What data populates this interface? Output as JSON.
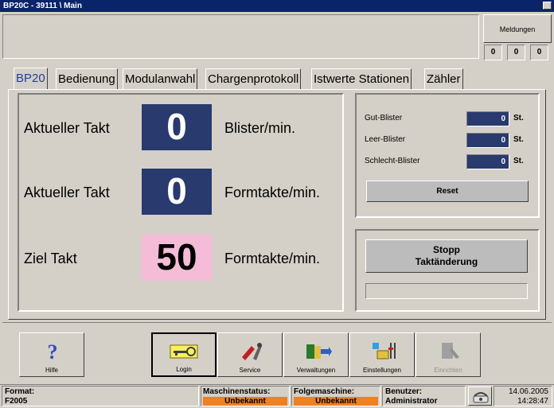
{
  "window": {
    "title": "BP20C - 39111 \\ Main"
  },
  "meldungen": {
    "label": "Meldungen",
    "counts": [
      "0",
      "0",
      "0"
    ]
  },
  "tabs": [
    "BP20",
    "Bedienung",
    "Modulanwahl",
    "Chargenprotokoll",
    "Istwerte Stationen",
    "Zähler"
  ],
  "main": {
    "row1": {
      "label": "Aktueller Takt",
      "value": "0",
      "unit": "Blister/min."
    },
    "row2": {
      "label": "Aktueller Takt",
      "value": "0",
      "unit": "Formtakte/min."
    },
    "row3": {
      "label": "Ziel Takt",
      "value": "50",
      "unit": "Formtakte/min."
    }
  },
  "counters": {
    "gut": {
      "label": "Gut-Blister",
      "value": "0",
      "unit": "St."
    },
    "leer": {
      "label": "Leer-Blister",
      "value": "0",
      "unit": "St."
    },
    "schlecht": {
      "label": "Schlecht-Blister",
      "value": "0",
      "unit": "St."
    },
    "reset_label": "Reset"
  },
  "stopp": {
    "line1": "Stopp",
    "line2": "Taktänderung"
  },
  "toolbar": {
    "hilfe": "Hilfe",
    "login": "Login",
    "service": "Service",
    "verwaltungen": "Verwaltungen",
    "einstellungen": "Einstellungen",
    "einrichten": "Einrichten"
  },
  "status": {
    "format_label": "Format:",
    "format_value": "F2005",
    "maschinen_label": "Maschinenstatus:",
    "maschinen_value": "Unbekannt",
    "folge_label": "Folgemaschine:",
    "folge_value": "Unbekannt",
    "benutzer_label": "Benutzer:",
    "benutzer_value": "Administrator",
    "date": "14.06.2005",
    "time": "14:28:47"
  },
  "colors": {
    "title_bar": "#0a246a",
    "value_dark": "#283a6e",
    "value_pink": "#f4bcd6",
    "status_orange": "#f08020",
    "tab_active": "#1f3fa0"
  }
}
